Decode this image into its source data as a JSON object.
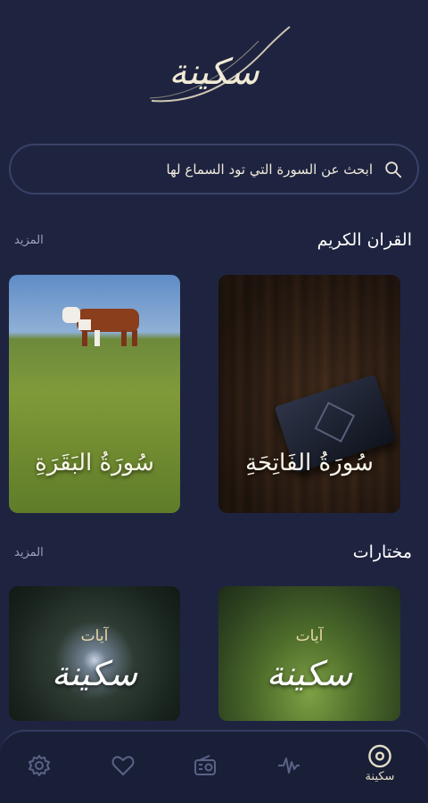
{
  "app": {
    "logo_text": "سكينة"
  },
  "search": {
    "placeholder": "ابحث عن السورة التي تود السماع لها"
  },
  "sections": {
    "quran": {
      "title": "القران الكريم",
      "more": "المزيد",
      "cards": [
        {
          "caption": "سُورَةُ الفَاتِحَةِ"
        },
        {
          "caption": "سُورَةُ البَقَرَةِ"
        }
      ]
    },
    "picks": {
      "title": "مختارات",
      "more": "المزيد",
      "cards": [
        {
          "small": "آيات",
          "big": "سكينة"
        },
        {
          "small": "آيات",
          "big": "سكينة"
        }
      ]
    }
  },
  "nav": {
    "items": [
      {
        "label": "سكينة",
        "icon": "disc-icon",
        "active": true
      },
      {
        "label": "",
        "icon": "waveform-icon"
      },
      {
        "label": "",
        "icon": "radio-icon"
      },
      {
        "label": "",
        "icon": "heart-icon"
      },
      {
        "label": "",
        "icon": "gear-icon"
      }
    ]
  },
  "colors": {
    "background": "#1e2440",
    "accent": "#e5ddc8",
    "muted": "#9ea3bb",
    "nav_icon_inactive": "#5a6286"
  }
}
